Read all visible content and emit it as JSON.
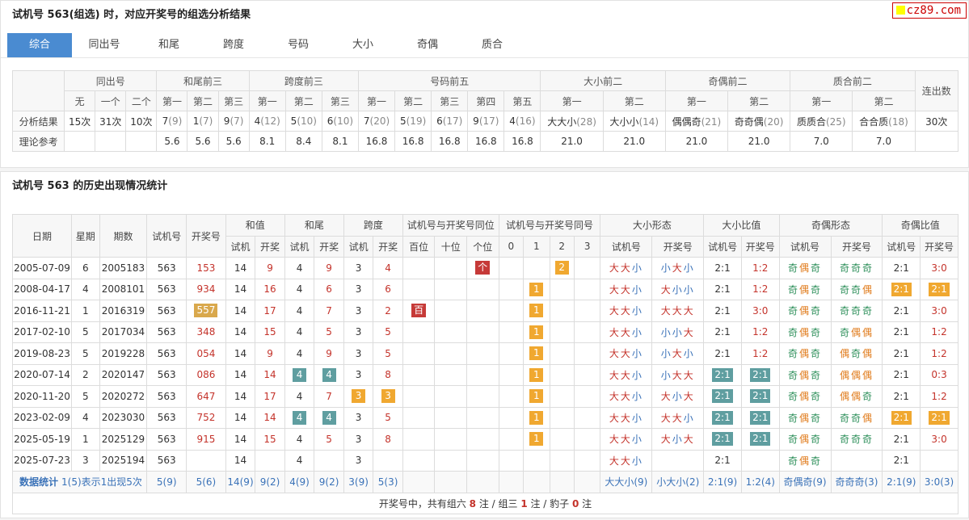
{
  "header": {
    "title": "试机号 563(组选) 时，对应开奖号的组选分析结果",
    "logo": "cz89.com"
  },
  "tabs": [
    "综合",
    "同出号",
    "和尾",
    "跨度",
    "号码",
    "大小",
    "奇偶",
    "质合"
  ],
  "t1": {
    "groups": [
      "同出号",
      "和尾前三",
      "跨度前三",
      "号码前五",
      "大小前二",
      "奇偶前二",
      "质合前二",
      "连出数"
    ],
    "subs": [
      "无",
      "一个",
      "二个",
      "第一",
      "第二",
      "第三",
      "第一",
      "第二",
      "第三",
      "第一",
      "第二",
      "第三",
      "第四",
      "第五",
      "第一",
      "第二",
      "第一",
      "第二",
      "第一",
      "第二"
    ],
    "row_labels": [
      "分析结果",
      "理论参考"
    ],
    "result": [
      [
        "15次",
        ""
      ],
      [
        "31次",
        ""
      ],
      [
        "10次",
        ""
      ],
      [
        "7",
        "(9)"
      ],
      [
        "1",
        "(7)"
      ],
      [
        "9",
        "(7)"
      ],
      [
        "4",
        "(12)"
      ],
      [
        "5",
        "(10)"
      ],
      [
        "6",
        "(10)"
      ],
      [
        "7",
        "(20)"
      ],
      [
        "5",
        "(19)"
      ],
      [
        "6",
        "(17)"
      ],
      [
        "9",
        "(17)"
      ],
      [
        "4",
        "(16)"
      ],
      [
        "大大小",
        "(28)"
      ],
      [
        "大小小",
        "(14)"
      ],
      [
        "偶偶奇",
        "(21)"
      ],
      [
        "奇奇偶",
        "(20)"
      ],
      [
        "质质合",
        "(25)"
      ],
      [
        "合合质",
        "(18)"
      ],
      [
        "30次",
        ""
      ]
    ],
    "theory": [
      "",
      "",
      "",
      "5.6",
      "5.6",
      "5.6",
      "8.1",
      "8.4",
      "8.1",
      "16.8",
      "16.8",
      "16.8",
      "16.8",
      "16.8",
      "21.0",
      "21.0",
      "21.0",
      "21.0",
      "7.0",
      "7.0",
      ""
    ]
  },
  "section2": {
    "title": "试机号 563 的历史出现情况统计"
  },
  "t2": {
    "h1": [
      "日期",
      "星期",
      "期数",
      "试机号",
      "开奖号",
      "和值",
      "和尾",
      "跨度",
      "试机号与开奖号同位",
      "试机号与开奖号同号",
      "大小形态",
      "大小比值",
      "奇偶形态",
      "奇偶比值"
    ],
    "h2": [
      "试机",
      "开奖",
      "试机",
      "开奖",
      "试机",
      "开奖",
      "百位",
      "十位",
      "个位",
      "0",
      "1",
      "2",
      "3",
      "试机号",
      "开奖号",
      "试机号",
      "开奖号",
      "试机号",
      "开奖号",
      "试机号",
      "开奖号"
    ],
    "rows": [
      {
        "date": "2005-07-09",
        "week": "6",
        "issue": "2005183",
        "sj": "563",
        "kj": "153",
        "hs": "14",
        "hk": "9",
        "ws": "4",
        "wk": "9",
        "ks": "3",
        "kk": "4",
        "tw": [
          "",
          "",
          "个"
        ],
        "th": [
          "",
          "",
          "2",
          ""
        ],
        "dxs": "大大小",
        "dxk": "小大小",
        "dbs": "2:1",
        "dbk": "1:2",
        "jos": "奇偶奇",
        "jok": "奇奇奇",
        "jbs": "2:1",
        "jbk": "3:0"
      },
      {
        "date": "2008-04-17",
        "week": "4",
        "issue": "2008101",
        "sj": "563",
        "kj": "934",
        "hs": "14",
        "hk": "16",
        "ws": "4",
        "wk": "6",
        "ks": "3",
        "kk": "6",
        "tw": [
          "",
          "",
          ""
        ],
        "th": [
          "",
          "1",
          "",
          ""
        ],
        "dxs": "大大小",
        "dxk": "大小小",
        "dbs": "2:1",
        "dbk": "1:2",
        "jos": "奇偶奇",
        "jok": "奇奇偶",
        "jbs": "2:1",
        "jbk": "2:1"
      },
      {
        "date": "2016-11-21",
        "week": "1",
        "issue": "2016319",
        "sj": "563",
        "kj": "557",
        "hs": "14",
        "hk": "17",
        "ws": "4",
        "wk": "7",
        "ks": "3",
        "kk": "2",
        "tw": [
          "百",
          "",
          ""
        ],
        "th": [
          "",
          "1",
          "",
          ""
        ],
        "dxs": "大大小",
        "dxk": "大大大",
        "dbs": "2:1",
        "dbk": "3:0",
        "jos": "奇偶奇",
        "jok": "奇奇奇",
        "jbs": "2:1",
        "jbk": "3:0"
      },
      {
        "date": "2017-02-10",
        "week": "5",
        "issue": "2017034",
        "sj": "563",
        "kj": "348",
        "hs": "14",
        "hk": "15",
        "ws": "4",
        "wk": "5",
        "ks": "3",
        "kk": "5",
        "tw": [
          "",
          "",
          ""
        ],
        "th": [
          "",
          "1",
          "",
          ""
        ],
        "dxs": "大大小",
        "dxk": "小小大",
        "dbs": "2:1",
        "dbk": "1:2",
        "jos": "奇偶奇",
        "jok": "奇偶偶",
        "jbs": "2:1",
        "jbk": "1:2"
      },
      {
        "date": "2019-08-23",
        "week": "5",
        "issue": "2019228",
        "sj": "563",
        "kj": "054",
        "hs": "14",
        "hk": "9",
        "ws": "4",
        "wk": "9",
        "ks": "3",
        "kk": "5",
        "tw": [
          "",
          "",
          ""
        ],
        "th": [
          "",
          "1",
          "",
          ""
        ],
        "dxs": "大大小",
        "dxk": "小大小",
        "dbs": "2:1",
        "dbk": "1:2",
        "jos": "奇偶奇",
        "jok": "偶奇偶",
        "jbs": "2:1",
        "jbk": "1:2"
      },
      {
        "date": "2020-07-14",
        "week": "2",
        "issue": "2020147",
        "sj": "563",
        "kj": "086",
        "hs": "14",
        "hk": "14",
        "ws": "4",
        "wk": "4",
        "ks": "3",
        "kk": "8",
        "tw": [
          "",
          "",
          ""
        ],
        "th": [
          "",
          "1",
          "",
          ""
        ],
        "dxs": "大大小",
        "dxk": "小大大",
        "dbs": "2:1",
        "dbk": "2:1",
        "jos": "奇偶奇",
        "jok": "偶偶偶",
        "jbs": "2:1",
        "jbk": "0:3"
      },
      {
        "date": "2020-11-20",
        "week": "5",
        "issue": "2020272",
        "sj": "563",
        "kj": "647",
        "hs": "14",
        "hk": "17",
        "ws": "4",
        "wk": "7",
        "ks": "3",
        "kk": "3",
        "tw": [
          "",
          "",
          ""
        ],
        "th": [
          "",
          "1",
          "",
          ""
        ],
        "dxs": "大大小",
        "dxk": "大小大",
        "dbs": "2:1",
        "dbk": "2:1",
        "jos": "奇偶奇",
        "jok": "偶偶奇",
        "jbs": "2:1",
        "jbk": "1:2"
      },
      {
        "date": "2023-02-09",
        "week": "4",
        "issue": "2023030",
        "sj": "563",
        "kj": "752",
        "hs": "14",
        "hk": "14",
        "ws": "4",
        "wk": "4",
        "ks": "3",
        "kk": "5",
        "tw": [
          "",
          "",
          ""
        ],
        "th": [
          "",
          "1",
          "",
          ""
        ],
        "dxs": "大大小",
        "dxk": "大大小",
        "dbs": "2:1",
        "dbk": "2:1",
        "jos": "奇偶奇",
        "jok": "奇奇偶",
        "jbs": "2:1",
        "jbk": "2:1"
      },
      {
        "date": "2025-05-19",
        "week": "1",
        "issue": "2025129",
        "sj": "563",
        "kj": "915",
        "hs": "14",
        "hk": "15",
        "ws": "4",
        "wk": "5",
        "ks": "3",
        "kk": "8",
        "tw": [
          "",
          "",
          ""
        ],
        "th": [
          "",
          "1",
          "",
          ""
        ],
        "dxs": "大大小",
        "dxk": "大小大",
        "dbs": "2:1",
        "dbk": "2:1",
        "jos": "奇偶奇",
        "jok": "奇奇奇",
        "jbs": "2:1",
        "jbk": "3:0"
      },
      {
        "date": "2025-07-23",
        "week": "3",
        "issue": "2025194",
        "sj": "563",
        "kj": "",
        "hs": "14",
        "hk": "",
        "ws": "4",
        "wk": "",
        "ks": "3",
        "kk": "",
        "tw": [
          "",
          "",
          ""
        ],
        "th": [
          "",
          "",
          "",
          ""
        ],
        "dxs": "大大小",
        "dxk": "",
        "dbs": "2:1",
        "dbk": "",
        "jos": "奇偶奇",
        "jok": "",
        "jbs": "2:1",
        "jbk": ""
      }
    ],
    "highlights": {
      "kj": {
        "2": "gd"
      },
      "hs_hk": {
        "5": "gr",
        "7": "gr"
      },
      "ws_wk": {
        "5": "gr",
        "7": "gr"
      },
      "ks_kk": {
        "6": "o"
      },
      "dbs_dbk": {
        "5": "gr",
        "6": "gr",
        "7": "gr",
        "8": "gr"
      },
      "jb": {
        "1": "o",
        "7": "o"
      }
    },
    "footer": {
      "label": "数据统计",
      "desc": "1(5)表示1出现5次",
      "cells": [
        "5(9)",
        "5(6)",
        "14(9)",
        "9(2)",
        "4(9)",
        "9(2)",
        "3(9)",
        "5(3)",
        "",
        "",
        "",
        "",
        "",
        "",
        "",
        "大大小(9)",
        "小大小(2)",
        "2:1(9)",
        "1:2(4)",
        "奇偶奇(9)",
        "奇奇奇(3)",
        "2:1(9)",
        "3:0(3)"
      ]
    },
    "note": {
      "prefix": "开奖号中，共有组六 ",
      "n1": "8",
      "mid1": " 注 / 组三 ",
      "n2": "1",
      "mid2": " 注 / 豹子 ",
      "n3": "0",
      "suffix": " 注"
    }
  }
}
